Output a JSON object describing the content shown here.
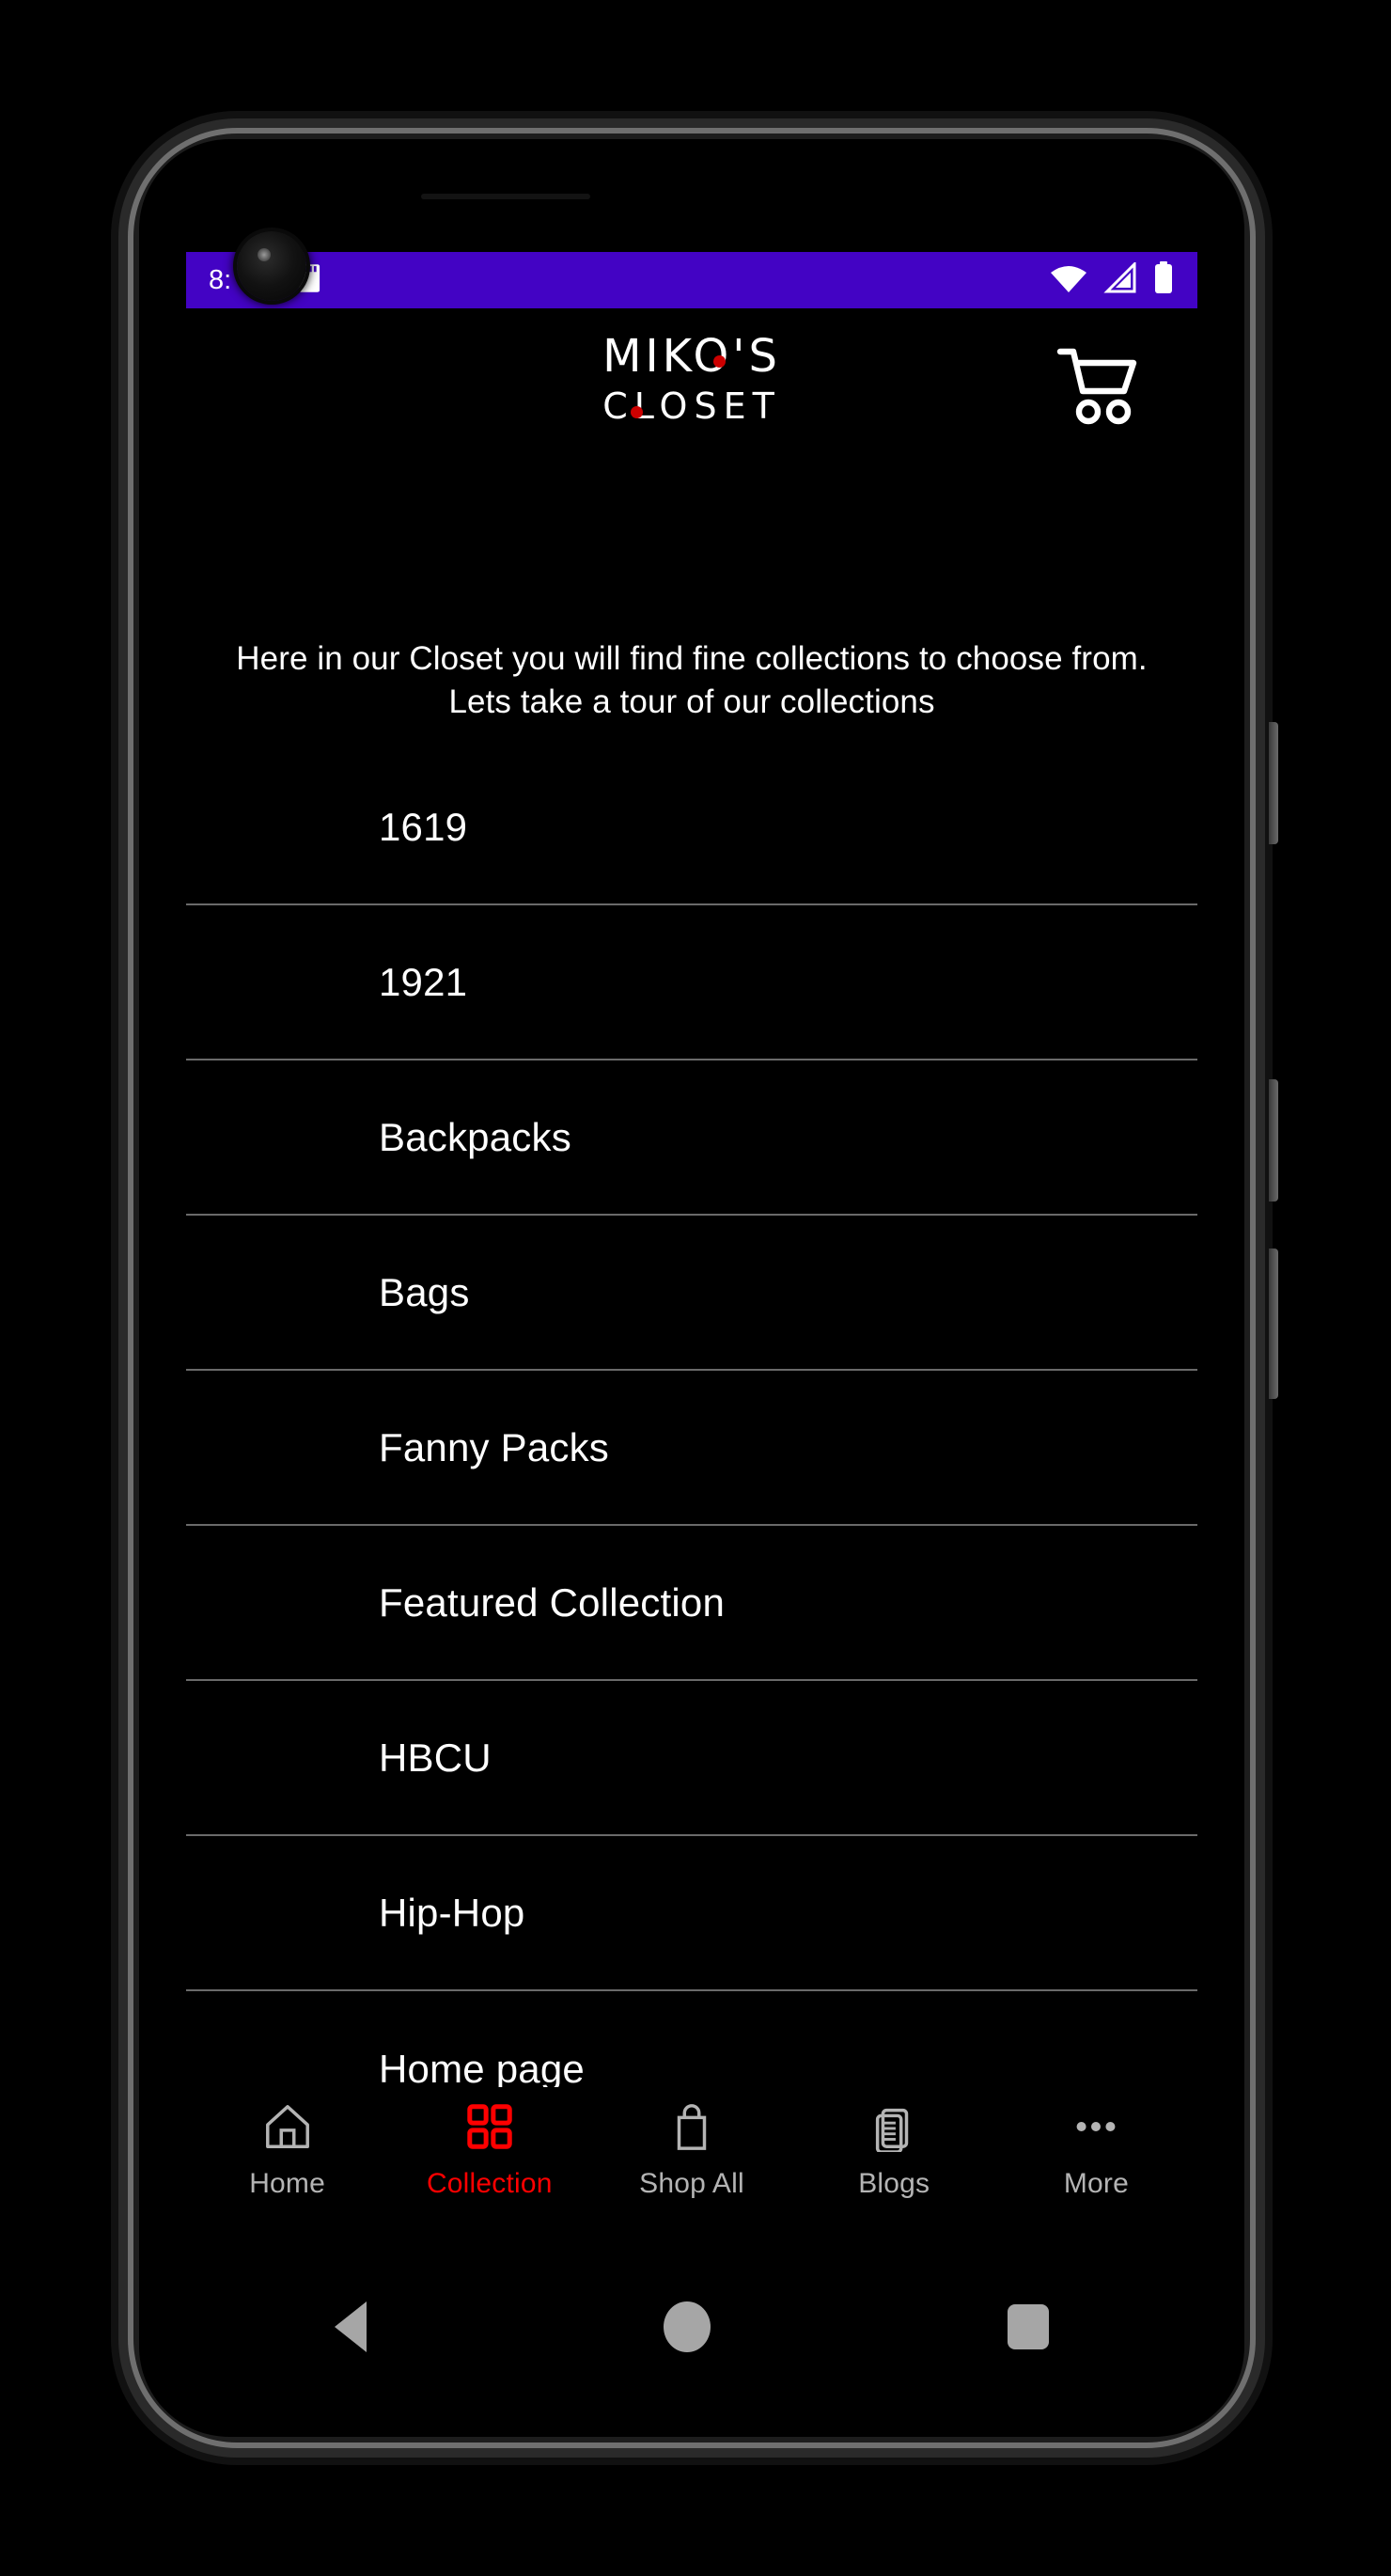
{
  "status_bar": {
    "time": "8:",
    "background_color": "#4303C4",
    "left_icons": [
      "notification-icon",
      "sd-card-icon"
    ],
    "right_icons": [
      "wifi-icon",
      "cellular-signal-icon",
      "battery-icon"
    ]
  },
  "header": {
    "logo_line1": "MIKO'S",
    "logo_line2": "CLOSET",
    "accent_color": "#cc0000",
    "cart_icon": "shopping-cart-icon"
  },
  "intro": {
    "text": "Here in our Closet you will find fine collections to choose from. Lets take a tour of our collections"
  },
  "collections": {
    "items": [
      {
        "label": "1619"
      },
      {
        "label": "1921"
      },
      {
        "label": "Backpacks"
      },
      {
        "label": "Bags"
      },
      {
        "label": "Fanny Packs"
      },
      {
        "label": "Featured Collection"
      },
      {
        "label": "HBCU"
      },
      {
        "label": "Hip-Hop"
      },
      {
        "label": "Home page"
      }
    ]
  },
  "tabbar": {
    "active_color": "#ff0000",
    "inactive_color": "#b4b4b4",
    "tabs": [
      {
        "label": "Home",
        "icon": "home-icon",
        "active": false
      },
      {
        "label": "Collection",
        "icon": "grid-icon",
        "active": true
      },
      {
        "label": "Shop All",
        "icon": "shopping-bag-icon",
        "active": false
      },
      {
        "label": "Blogs",
        "icon": "documents-icon",
        "active": false
      },
      {
        "label": "More",
        "icon": "ellipsis-icon",
        "active": false
      }
    ]
  },
  "android_nav": {
    "back": "back-triangle-icon",
    "home": "home-circle-icon",
    "recents": "recents-square-icon"
  }
}
